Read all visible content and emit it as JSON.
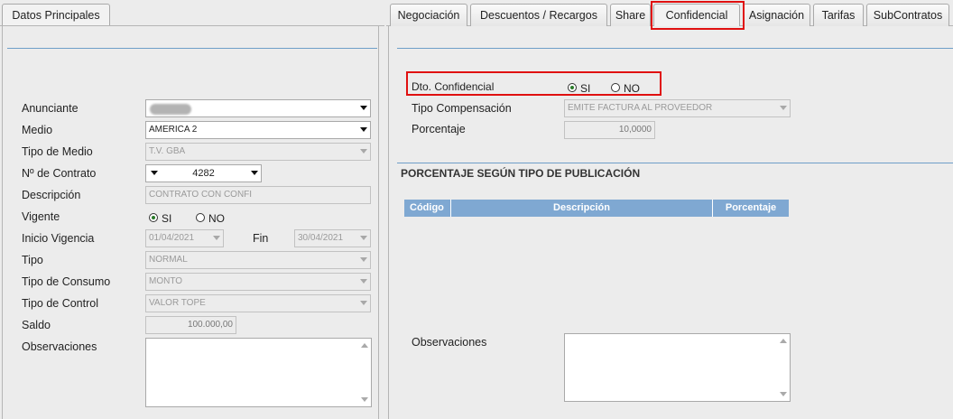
{
  "left": {
    "tab_label": "Datos Principales",
    "fields": {
      "anunciante": {
        "label": "Anunciante",
        "value": ""
      },
      "medio": {
        "label": "Medio",
        "value": "AMERICA 2"
      },
      "tipo_medio": {
        "label": "Tipo de Medio",
        "value": "T.V. GBA"
      },
      "contrato": {
        "label": "Nº de Contrato",
        "value": "4282"
      },
      "descripcion": {
        "label": "Descripción",
        "value": "CONTRATO CON CONFI"
      },
      "vigente": {
        "label": "Vigente",
        "si": "SI",
        "no": "NO"
      },
      "inicio": {
        "label": "Inicio Vigencia",
        "value": "01/04/2021"
      },
      "fin": {
        "label": "Fin",
        "value": "30/04/2021"
      },
      "tipo": {
        "label": "Tipo",
        "value": "NORMAL"
      },
      "tipo_consumo": {
        "label": "Tipo de Consumo",
        "value": "MONTO"
      },
      "tipo_control": {
        "label": "Tipo de Control",
        "value": "VALOR TOPE"
      },
      "saldo": {
        "label": "Saldo",
        "value": "100.000,00"
      },
      "observaciones": {
        "label": "Observaciones"
      }
    }
  },
  "right": {
    "tabs": [
      "Negociación",
      "Descuentos / Recargos",
      "Share",
      "Confidencial",
      "Asignación",
      "Tarifas",
      "SubContratos"
    ],
    "active_tab": "Confidencial",
    "dto": {
      "label": "Dto. Confidencial",
      "si": "SI",
      "no": "NO",
      "selected": "SI"
    },
    "tipo_compensacion": {
      "label": "Tipo Compensación",
      "value": "EMITE FACTURA AL PROVEEDOR"
    },
    "porcentaje": {
      "label": "Porcentaje",
      "value": "10,0000"
    },
    "section_title": "PORCENTAJE SEGÚN TIPO DE PUBLICACIÓN",
    "table_headers": [
      "Código",
      "Descripción",
      "Porcentaje"
    ],
    "observaciones": {
      "label": "Observaciones"
    }
  },
  "colors": {
    "highlight": "#e01010",
    "table_header": "#7fa8d2",
    "divider": "#6f9fc8"
  }
}
